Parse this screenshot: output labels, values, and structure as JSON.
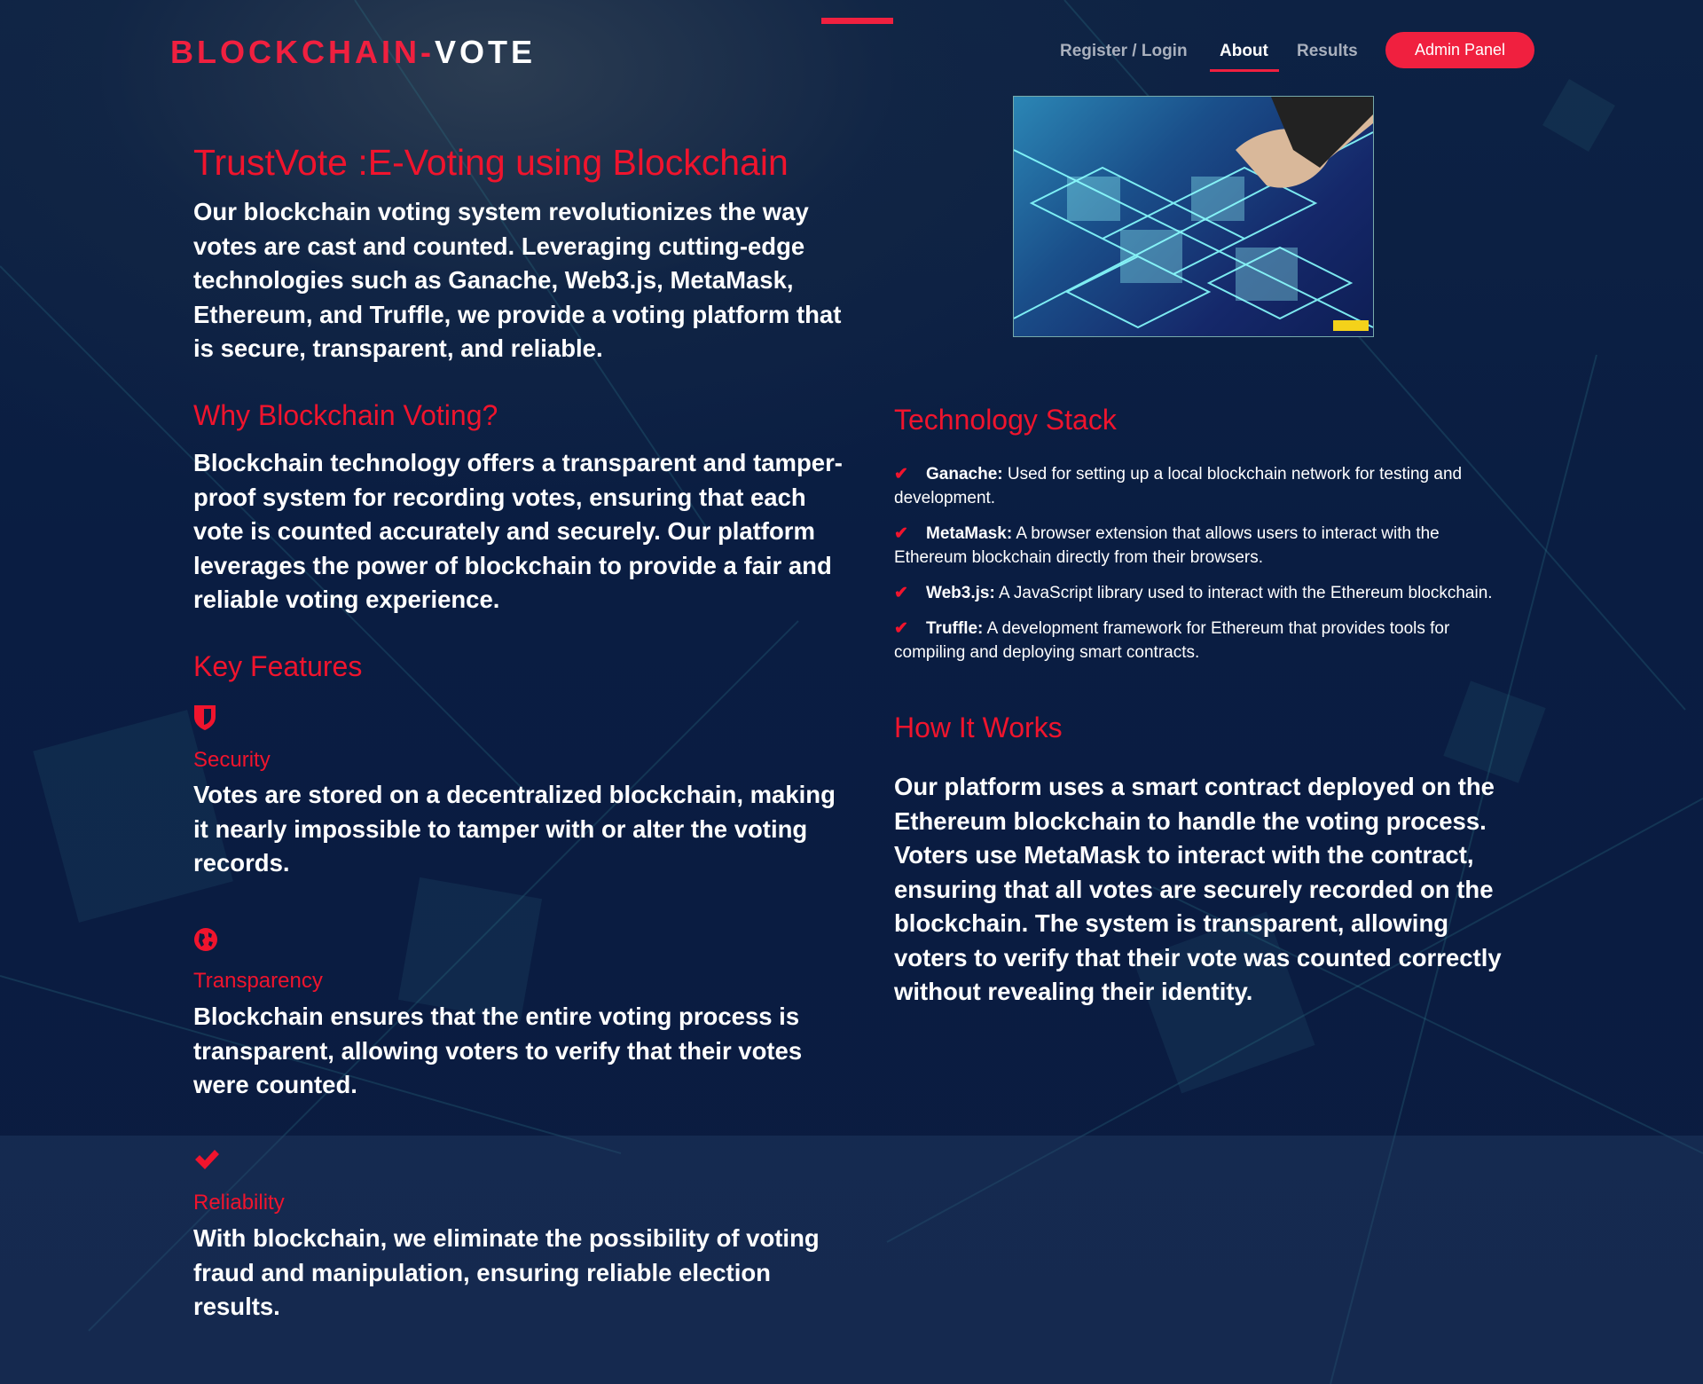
{
  "header": {
    "logo_part1": "BLOCKCHAIN-",
    "logo_part2": "VOTE",
    "nav": [
      {
        "label": "Register / Login"
      },
      {
        "label": "About",
        "active": true
      },
      {
        "label": "Results"
      }
    ],
    "admin_button": "Admin Panel"
  },
  "colors": {
    "accent": "#f0142d",
    "background": "#0b1b40",
    "text": "#ffffff"
  },
  "main": {
    "title": "TrustVote :E-Voting using Blockchain",
    "intro": "Our blockchain voting system revolutionizes the way votes are cast and counted. Leveraging cutting-edge technologies such as Ganache, Web3.js, MetaMask, Ethereum, and Truffle, we provide a voting platform that is secure, transparent, and reliable.",
    "why_heading": "Why Blockchain Voting?",
    "why_text": "Blockchain technology offers a transparent and tamper-proof system for recording votes, ensuring that each vote is counted accurately and securely. Our platform leverages the power of blockchain to provide a fair and reliable voting experience.",
    "features_heading": "Key Features",
    "features": [
      {
        "icon": "shield-icon",
        "title": "Security",
        "text": "Votes are stored on a decentralized blockchain, making it nearly impossible to tamper with or alter the voting records."
      },
      {
        "icon": "globe-icon",
        "title": "Transparency",
        "text": "Blockchain ensures that the entire voting process is transparent, allowing voters to verify that their votes were counted."
      },
      {
        "icon": "check-icon",
        "title": "Reliability",
        "text": "With blockchain, we eliminate the possibility of voting fraud and manipulation, ensuring reliable election results."
      }
    ],
    "tech_heading": "Technology Stack",
    "tech": [
      {
        "name": "Ganache:",
        "desc": " Used for setting up a local blockchain network for testing and development."
      },
      {
        "name": "MetaMask:",
        "desc": " A browser extension that allows users to interact with the Ethereum blockchain directly from their browsers."
      },
      {
        "name": "Web3.js:",
        "desc": " A JavaScript library used to interact with the Ethereum blockchain."
      },
      {
        "name": "Truffle:",
        "desc": " A development framework for Ethereum that provides tools for compiling and deploying smart contracts."
      }
    ],
    "how_heading": "How It Works",
    "how_text": "Our platform uses a smart contract deployed on the Ethereum blockchain to handle the voting process. Voters use MetaMask to interact with the contract, ensuring that all votes are securely recorded on the blockchain. The system is transparent, allowing voters to verify that their vote was counted correctly without revealing their identity."
  }
}
